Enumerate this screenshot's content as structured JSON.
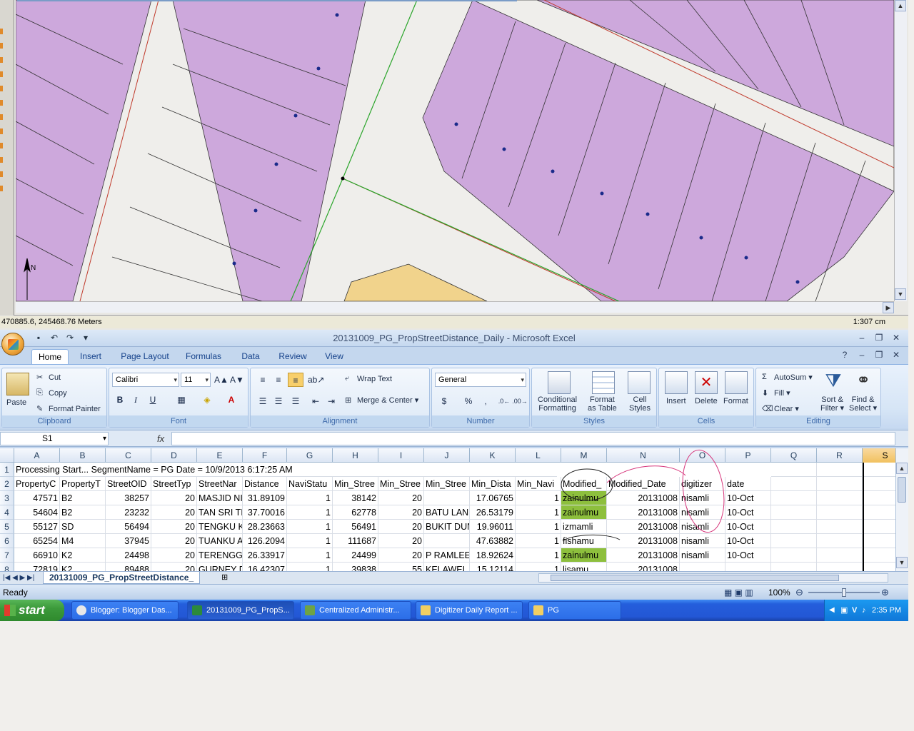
{
  "gis": {
    "coordinates": "470885.6, 245468.76 Meters",
    "scale": "1:307 cm"
  },
  "excel": {
    "title": "20131009_PG_PropStreetDistance_Daily - Microsoft Excel",
    "tabs": [
      "Home",
      "Insert",
      "Page Layout",
      "Formulas",
      "Data",
      "Review",
      "View"
    ],
    "clipboard": {
      "group": "Clipboard",
      "paste": "Paste",
      "cut": "Cut",
      "copy": "Copy",
      "format_painter": "Format Painter"
    },
    "font": {
      "group": "Font",
      "name": "Calibri",
      "size": "11"
    },
    "alignment": {
      "group": "Alignment",
      "wrap": "Wrap Text",
      "merge": "Merge & Center"
    },
    "number": {
      "group": "Number",
      "format": "General"
    },
    "styles": {
      "group": "Styles",
      "conditional_1": "Conditional",
      "conditional_2": "Formatting",
      "format_table_1": "Format",
      "format_table_2": "as Table",
      "cell_styles_1": "Cell",
      "cell_styles_2": "Styles"
    },
    "cells": {
      "group": "Cells",
      "insert": "Insert",
      "delete": "Delete",
      "format": "Format"
    },
    "editing": {
      "group": "Editing",
      "autosum": "AutoSum",
      "fill": "Fill",
      "clear": "Clear",
      "sort_1": "Sort &",
      "sort_2": "Filter",
      "find_1": "Find &",
      "find_2": "Select"
    },
    "name_box": "S1",
    "fx": "fx",
    "columns": [
      "A",
      "B",
      "C",
      "D",
      "E",
      "F",
      "G",
      "H",
      "I",
      "J",
      "K",
      "L",
      "M",
      "N",
      "O",
      "P",
      "Q",
      "R",
      "S"
    ],
    "row_numbers": [
      "1",
      "2",
      "3",
      "4",
      "5",
      "6",
      "7",
      "8"
    ],
    "row1": "Processing Start... SegmentName = PG Date = 10/9/2013 6:17:25 AM",
    "headers": [
      "PropertyC",
      "PropertyT",
      "StreetOID",
      "StreetTyp",
      "StreetNar",
      "Distance",
      "NaviStatu",
      "Min_Stree",
      "Min_Stree",
      "Min_Stree",
      "Min_Dista",
      "Min_Navi",
      "Modified_",
      "Modified_Date",
      "digitizer",
      "date"
    ],
    "rows": [
      [
        "47571",
        "B2",
        "38257",
        "20",
        "MASJID NI",
        "31.89109",
        "1",
        "38142",
        "20",
        "",
        "17.06765",
        "1",
        "zainulmu",
        "20131008",
        "nisamli",
        "10-Oct"
      ],
      [
        "54604",
        "B2",
        "23232",
        "20",
        "TAN SRI TI",
        "37.70016",
        "1",
        "62778",
        "20",
        "BATU LAN",
        "26.53179",
        "1",
        "zainulmu",
        "20131008",
        "nisamli",
        "10-Oct"
      ],
      [
        "55127",
        "SD",
        "56494",
        "20",
        "TENGKU K",
        "28.23663",
        "1",
        "56491",
        "20",
        "BUKIT DUN",
        "19.96011",
        "1",
        "izmamli",
        "20131008",
        "nisamli",
        "10-Oct"
      ],
      [
        "65254",
        "M4",
        "37945",
        "20",
        "TUANKU A",
        "126.2094",
        "1",
        "111687",
        "20",
        "",
        "47.63882",
        "1",
        "fishamu",
        "20131008",
        "nisamli",
        "10-Oct"
      ],
      [
        "66910",
        "K2",
        "24498",
        "20",
        "TERENGGA",
        "26.33917",
        "1",
        "24499",
        "20",
        "P RAMLEE",
        "18.92624",
        "1",
        "zainulmu",
        "20131008",
        "nisamli",
        "10-Oct"
      ],
      [
        "72819",
        "K2",
        "89488",
        "20",
        "GURNEY D",
        "16.42307",
        "1",
        "39838",
        "55",
        "KELAWEI",
        "15.12114",
        "1",
        "lisamu",
        "20131008",
        "",
        ""
      ]
    ],
    "sheet_tab": "20131009_PG_PropStreetDistance_",
    "status": "Ready",
    "zoom": "100%"
  },
  "taskbar": {
    "start": "start",
    "tasks": [
      "Blogger: Blogger Das...",
      "20131009_PG_PropS...",
      "Centralized Administr...",
      "Digitizer Daily Report ...",
      "PG"
    ],
    "clock": "2:35 PM"
  }
}
